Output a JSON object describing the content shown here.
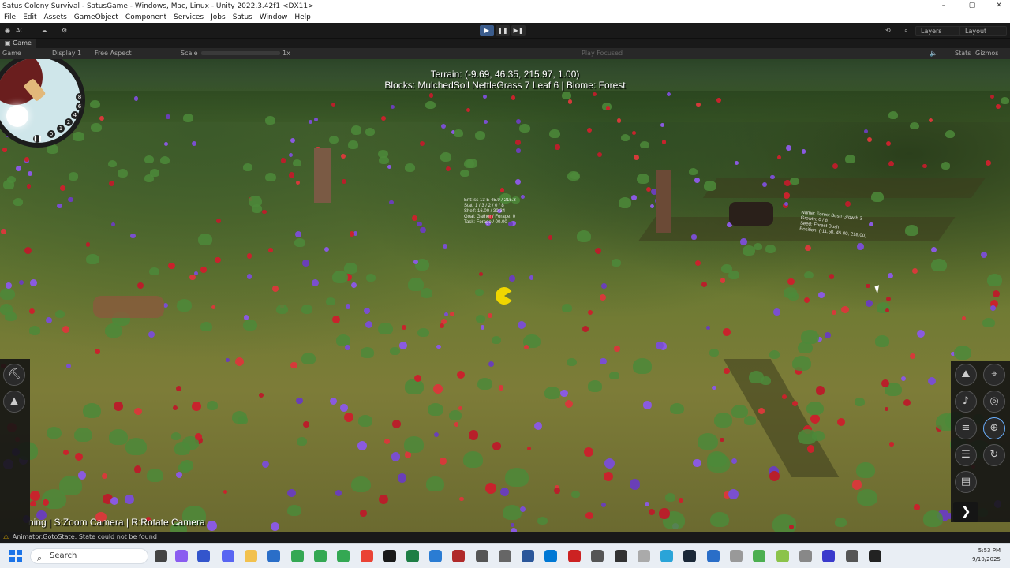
{
  "window": {
    "title": "Satus Colony Survival - SatusGame - Windows, Mac, Linux - Unity 2022.3.42f1 <DX11>",
    "controls": [
      "–",
      "▢",
      "✕"
    ]
  },
  "menu": {
    "items": [
      "File",
      "Edit",
      "Assets",
      "GameObject",
      "Component",
      "Services",
      "Jobs",
      "Satus",
      "Window",
      "Help"
    ]
  },
  "toolbar": {
    "account": "AC",
    "play_controls": [
      "▶",
      "❚❚",
      "▶❚"
    ],
    "layers_label": "Layers",
    "layout_label": "Layout"
  },
  "game_tab": {
    "label": "Game",
    "display": "Display 1",
    "aspect": "Free Aspect",
    "scale_label": "Scale",
    "scale_value": "1x",
    "play_mode": "Play Focused",
    "stats": "Stats",
    "gizmos": "Gizmos"
  },
  "hud": {
    "terrain_line": "Terrain: (-9.69, 46.35, 215.97, 1.00)",
    "blocks_line": "Blocks: MulchedSoil NettleGrass 7 Leaf 6 | Biome: Forest",
    "hint": "ning | S:Zoom Camera | R:Rotate Camera",
    "clock_numbers": [
      "8",
      "6",
      "4",
      "2",
      "1",
      "0"
    ]
  },
  "world_labels": {
    "unit_info": [
      "Ent: ss 13 E 45.9 / 215.3",
      "Stat: 1 / 3 / 2 / 0 / 8",
      "Shelf: 16.00 / 30.34",
      "Goal: Gather / Forage: 0",
      "Task: Forage / 00.00"
    ],
    "plant_info": [
      "Name: Forest Bush Growth 3",
      "Growth: 0 / 8",
      "Seed: Forest Bush",
      "Position: (-11.50, 45.00, 218.00)"
    ]
  },
  "status": {
    "message": "Animator.GotoState: State could not be found"
  },
  "taskbar": {
    "search_placeholder": "Search",
    "time": "5:53 PM",
    "date": "9/10/2025"
  },
  "colors": {
    "accent": "#3b5c8c",
    "editor_bg": "#191919",
    "warning": "#e0b000"
  }
}
